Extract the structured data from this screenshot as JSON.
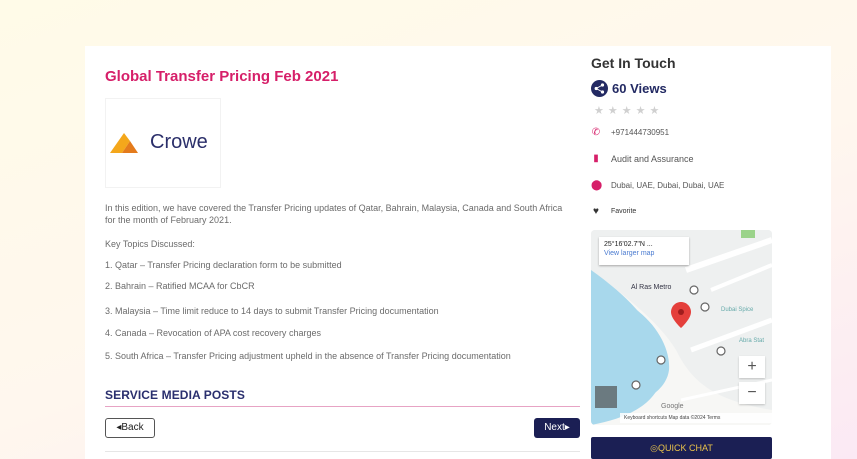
{
  "post": {
    "title": "Global Transfer Pricing Feb 2021",
    "logo_text": "Crowe",
    "intro": "In this edition, we have covered the Transfer Pricing updates of Qatar, Bahrain, Malaysia, Canada and South Africa for the month of February 2021.",
    "key_topics_label": "Key Topics Discussed:",
    "topics": [
      "1. Qatar – Transfer Pricing declaration form to be submitted",
      "2. Bahrain – Ratified MCAA for CbCR",
      "3. Malaysia – Time limit reduce to 14 days to submit Transfer Pricing documentation",
      "4. Canada – Revocation of APA cost recovery charges",
      "5. South Africa – Transfer Pricing adjustment upheld in the absence of Transfer Pricing documentation"
    ]
  },
  "section": {
    "title": "SERVICE MEDIA POSTS",
    "back_label": "◂Back",
    "next_label": "Next▸"
  },
  "sidebar": {
    "title": "Get In Touch",
    "views": "60 Views",
    "stars": "★★★★★",
    "phone": "+971444730951",
    "category": "Audit and Assurance",
    "location": "Dubai, UAE, Dubai, Dubai, UAE",
    "favorite": "Favorite",
    "quick_chat": "QUICK CHAT"
  },
  "map": {
    "coords": "25°16'02.7\"N ...",
    "larger_map": "View larger map",
    "metro_label": "Al Ras Metro",
    "dubai_spice": "Dubai Spice",
    "abra": "Abra Stat",
    "al_khor": "Al Khor",
    "zoom_in": "+",
    "zoom_out": "−",
    "footer": "Keyboard shortcuts   Map data ©2024   Terms",
    "google": "Google"
  },
  "colors": {
    "accent": "#d61f69",
    "navy": "#1b1f54",
    "chat_text": "#e9c34a"
  }
}
